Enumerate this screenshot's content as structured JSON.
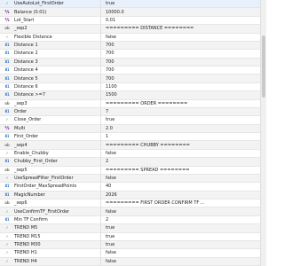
{
  "rows": [
    {
      "name": "UseAutoLot_FirstOrder",
      "value": "true",
      "type": "bool"
    },
    {
      "name": "Balance (0.01)",
      "value": "10000.0",
      "type": "dbl"
    },
    {
      "name": "Lot_Start",
      "value": "0.01",
      "type": "dbl"
    },
    {
      "name": "_sep2",
      "value": "========= DISTANCE ========",
      "type": "sep"
    },
    {
      "name": "Flexible Distance",
      "value": "false",
      "type": "bool"
    },
    {
      "name": "Distance 1",
      "value": "700",
      "type": "num"
    },
    {
      "name": "Distance 2",
      "value": "700",
      "type": "num"
    },
    {
      "name": "Distance 3",
      "value": "700",
      "type": "num"
    },
    {
      "name": "Distance 4",
      "value": "700",
      "type": "num"
    },
    {
      "name": "Distance 5",
      "value": "700",
      "type": "num"
    },
    {
      "name": "Distance 6",
      "value": "1100",
      "type": "num"
    },
    {
      "name": "Distance >=7",
      "value": "1500",
      "type": "num"
    },
    {
      "name": "_sep3",
      "value": "========= ORDER ========",
      "type": "sep"
    },
    {
      "name": "Order",
      "value": "7",
      "type": "num"
    },
    {
      "name": "Close_Order",
      "value": "true",
      "type": "bool"
    },
    {
      "name": "Multi",
      "value": "2.0",
      "type": "dbl"
    },
    {
      "name": "First_Order",
      "value": "1",
      "type": "num"
    },
    {
      "name": "_sep4",
      "value": "========= CHUBBY ========",
      "type": "sep"
    },
    {
      "name": "Enable_Chubby",
      "value": "false",
      "type": "bool"
    },
    {
      "name": "Chubby_First_Order",
      "value": "2",
      "type": "num"
    },
    {
      "name": "_sep5",
      "value": "========= SPREAD ========",
      "type": "sep"
    },
    {
      "name": "UseSpreadFilter_FirstOrder",
      "value": "false",
      "type": "bool"
    },
    {
      "name": "FirstOrder_MaxSpreadPoints",
      "value": "40",
      "type": "num"
    },
    {
      "name": "MagicNumber",
      "value": "2026",
      "type": "num"
    },
    {
      "name": "_sep6",
      "value": "========= FIRST ORDER CONFIRM TF ...",
      "type": "sep"
    },
    {
      "name": "UseConfirmTF_FirstOrder",
      "value": "false",
      "type": "bool"
    },
    {
      "name": "Min TF Confirm",
      "value": "2",
      "type": "num"
    },
    {
      "name": "TREND M5",
      "value": "true",
      "type": "bool"
    },
    {
      "name": "TREND M15",
      "value": "true",
      "type": "bool"
    },
    {
      "name": "TREND M30",
      "value": "true",
      "type": "bool"
    },
    {
      "name": "TREND H1",
      "value": "false",
      "type": "bool"
    },
    {
      "name": "TREND H4",
      "value": "false",
      "type": "bool"
    }
  ],
  "icons": {
    "bool": "✓",
    "num": "01",
    "dbl": "½",
    "str": "ab",
    "sep": "ab"
  }
}
